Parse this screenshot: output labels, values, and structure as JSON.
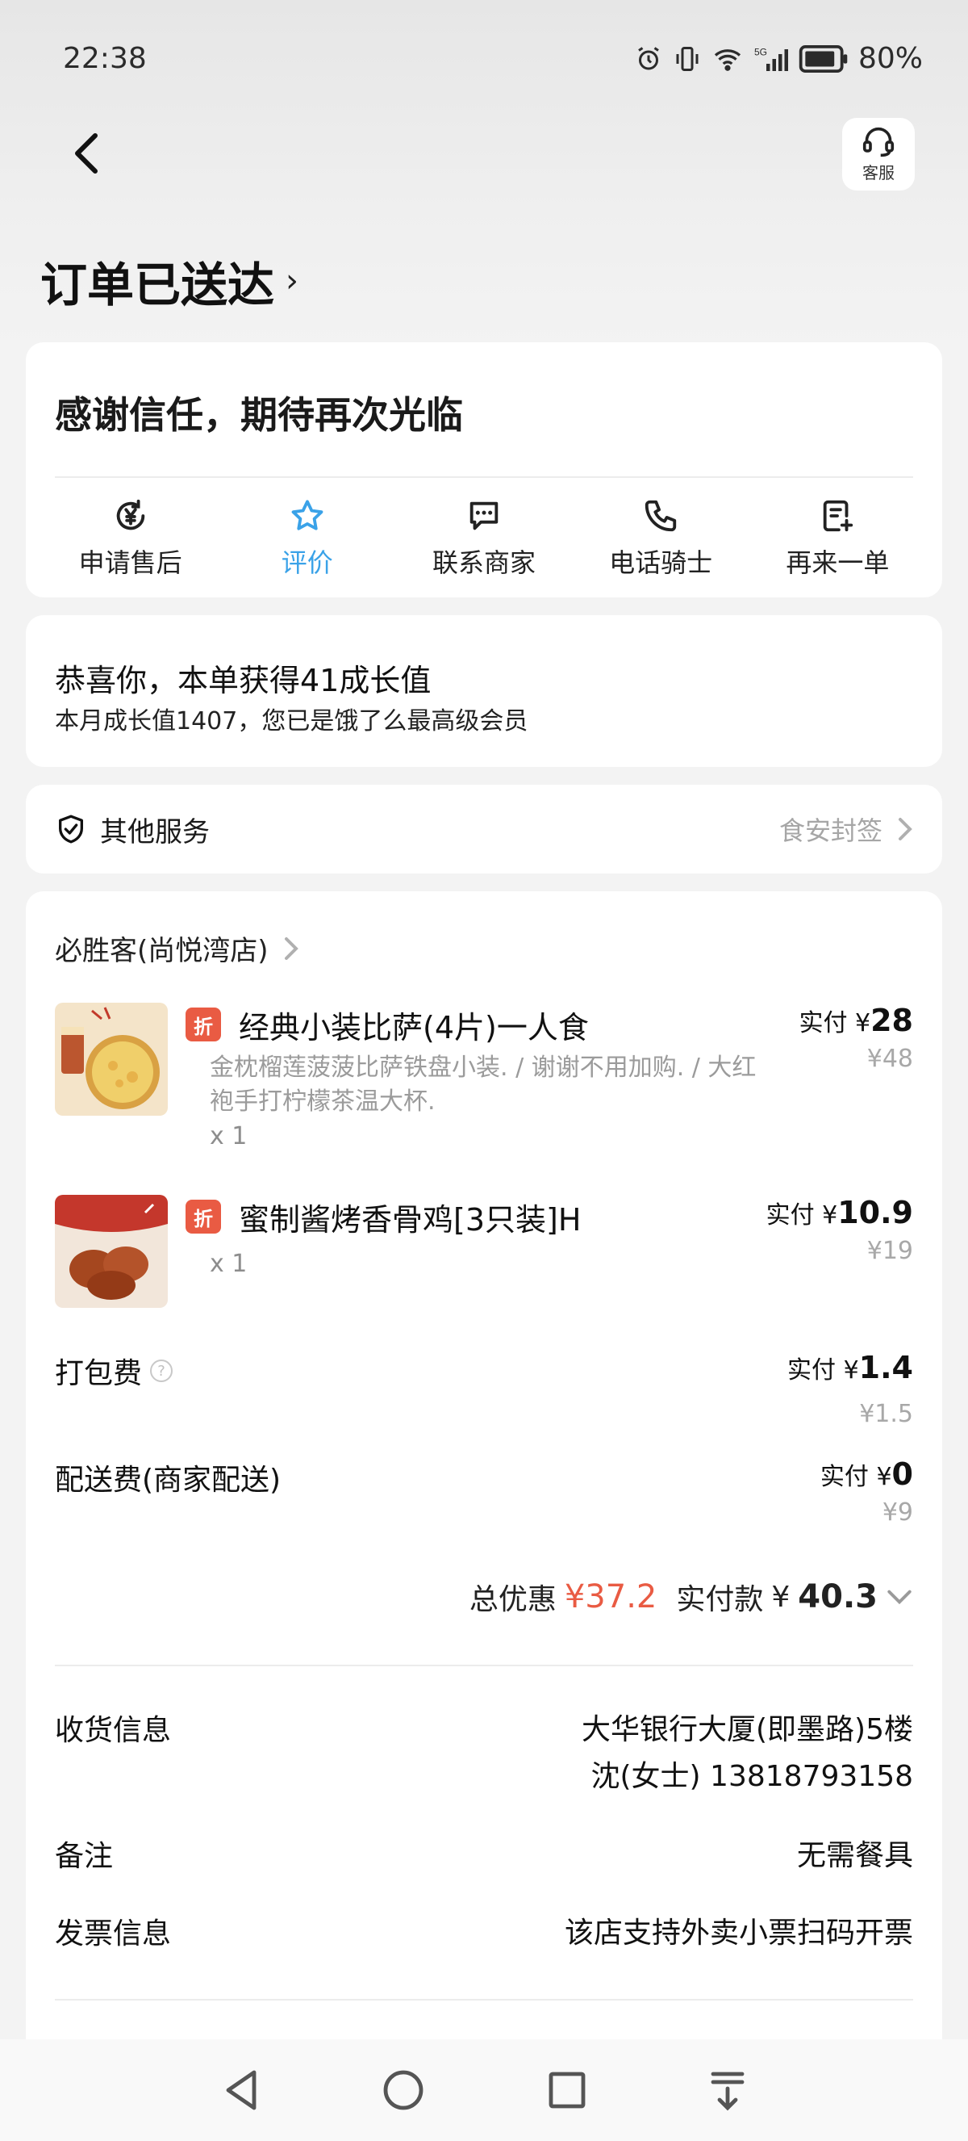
{
  "status_bar": {
    "time": "22:38",
    "battery": "80%",
    "network": "5G"
  },
  "header": {
    "service_label": "客服",
    "order_title": "订单已送达"
  },
  "thanks_card": {
    "message": "感谢信任，期待再次光临",
    "actions": [
      {
        "label": "申请售后",
        "icon": "yuan-refresh-icon"
      },
      {
        "label": "评价",
        "icon": "star-icon"
      },
      {
        "label": "联系商家",
        "icon": "chat-icon"
      },
      {
        "label": "电话骑士",
        "icon": "phone-icon"
      },
      {
        "label": "再来一单",
        "icon": "reorder-icon"
      }
    ],
    "active_color": "#3aa2e8"
  },
  "growth_card": {
    "line1": "恭喜你，本单获得41成长值",
    "line2": "本月成长值1407，您已是饿了么最高级会员"
  },
  "services_card": {
    "label": "其他服务",
    "right_text": "食安封签"
  },
  "order": {
    "shop_name": "必胜客(尚悦湾店)",
    "items": [
      {
        "badge": "折",
        "name": "经典小装比萨(4片)一人食",
        "desc": "金枕榴莲菠菠比萨铁盘小装. / 谢谢不用加购. / 大红袍手打柠檬茶温大杯.",
        "qty": "x 1",
        "paid_label": "实付 ¥",
        "paid_value": "28",
        "original": "¥48"
      },
      {
        "badge": "折",
        "name": "蜜制酱烤香骨鸡[3只装]H",
        "desc": "",
        "qty": "x 1",
        "paid_label": "实付 ¥",
        "paid_value": "10.9",
        "original": "¥19"
      }
    ],
    "packing_fee": {
      "label": "打包费",
      "paid_label": "实付 ¥",
      "paid_value": "1.4",
      "original": "¥1.5"
    },
    "delivery_fee": {
      "label": "配送费(商家配送)",
      "paid_label": "实付 ¥",
      "paid_value": "0",
      "original": "¥9"
    },
    "totals": {
      "discount_label": "总优惠",
      "discount_value": "¥37.2",
      "paid_label": "实付款",
      "paid_currency": "¥",
      "paid_value": "40.3"
    },
    "delivery_info": {
      "label": "收货信息",
      "address": "大华银行大厦(即墨路)5楼",
      "contact": "沈(女士) 13818793158"
    },
    "remark": {
      "label": "备注",
      "value": "无需餐具"
    },
    "invoice": {
      "label": "发票信息",
      "value": "该店支持外卖小票扫码开票"
    }
  },
  "colors": {
    "accent_blue": "#3aa2e8",
    "discount_red": "#e95b43"
  }
}
